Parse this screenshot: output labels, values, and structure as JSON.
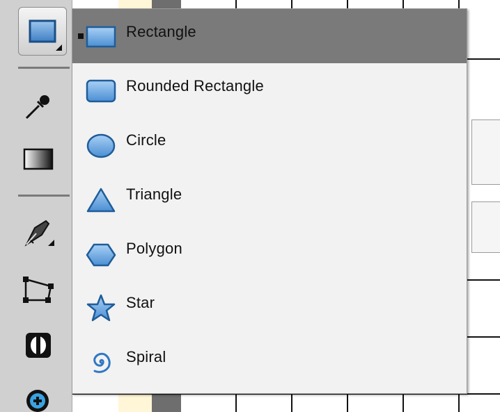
{
  "menu": {
    "items": [
      {
        "label": "Rectangle",
        "icon": "rectangle-icon",
        "selected": true
      },
      {
        "label": "Rounded Rectangle",
        "icon": "rounded-rectangle-icon",
        "selected": false
      },
      {
        "label": "Circle",
        "icon": "circle-icon",
        "selected": false
      },
      {
        "label": "Triangle",
        "icon": "triangle-icon",
        "selected": false
      },
      {
        "label": "Polygon",
        "icon": "polygon-icon",
        "selected": false
      },
      {
        "label": "Star",
        "icon": "star-icon",
        "selected": false
      },
      {
        "label": "Spiral",
        "icon": "spiral-icon",
        "selected": false
      }
    ]
  },
  "toolbar": {
    "tools": [
      {
        "name": "shape-tool",
        "icon": "rectangle-icon",
        "active": true
      },
      {
        "name": "eyedropper-tool",
        "icon": "eyedropper-icon"
      },
      {
        "name": "gradient-tool",
        "icon": "gradient-icon"
      },
      {
        "name": "pen-tool",
        "icon": "pen-icon"
      },
      {
        "name": "transform-tool",
        "icon": "distort-icon"
      },
      {
        "name": "mask-tool",
        "icon": "mask-icon"
      },
      {
        "name": "zoom-tool",
        "icon": "zoom-icon"
      }
    ]
  },
  "colors": {
    "shape_fill": "#5b9bd5",
    "shape_stroke": "#1f5d9a",
    "menu_selected": "#7a7a7a",
    "menu_bg": "#f2f2f2",
    "toolbar_bg": "#d0d0d0"
  }
}
